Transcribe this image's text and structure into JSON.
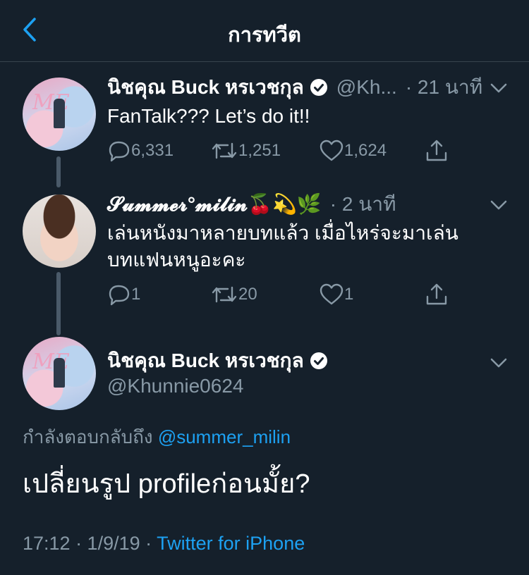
{
  "header": {
    "title": "การทวีต",
    "back_icon": "chevron-left-icon",
    "accent": "#1da1f2"
  },
  "colors": {
    "background": "#15202b",
    "secondary_text": "#8899a6",
    "link": "#1da1f2",
    "divider": "#38444d"
  },
  "tweets": [
    {
      "name": "นิชคุณ Buck หรเวชกุล",
      "verified": true,
      "handle": "@Kh...",
      "time": "· 21 นาที",
      "text": "FanTalk??? Let’s do it!!",
      "actions": {
        "reply": "6,331",
        "retweet": "1,251",
        "like": "1,624"
      }
    },
    {
      "name": "𝓢𝓾𝓶𝓶𝓮𝓻°𝓶𝓲𝓵𝓲𝓷🍒💫🌿",
      "verified": false,
      "handle": "",
      "time": "· 2 นาที",
      "text_line1": "เล่นหนังมาหลายบทแล้ว เมื่อไหร่จะมาเล่น",
      "text_line2": "บทแฟนหนูอะคะ",
      "actions": {
        "reply": "1",
        "retweet": "20",
        "like": "1"
      }
    }
  ],
  "focused": {
    "name": "นิชคุณ Buck หรเวชกุล",
    "verified": true,
    "handle": "@Khunnie0624",
    "reply_prefix": "กำลังตอบกลับถึง",
    "reply_mention": "@summer_milin",
    "text": "เปลี่ยนรูป profileก่อนมั้ย?",
    "timestamp": "17:12 · 1/9/19 · ",
    "source": "Twitter for iPhone"
  }
}
